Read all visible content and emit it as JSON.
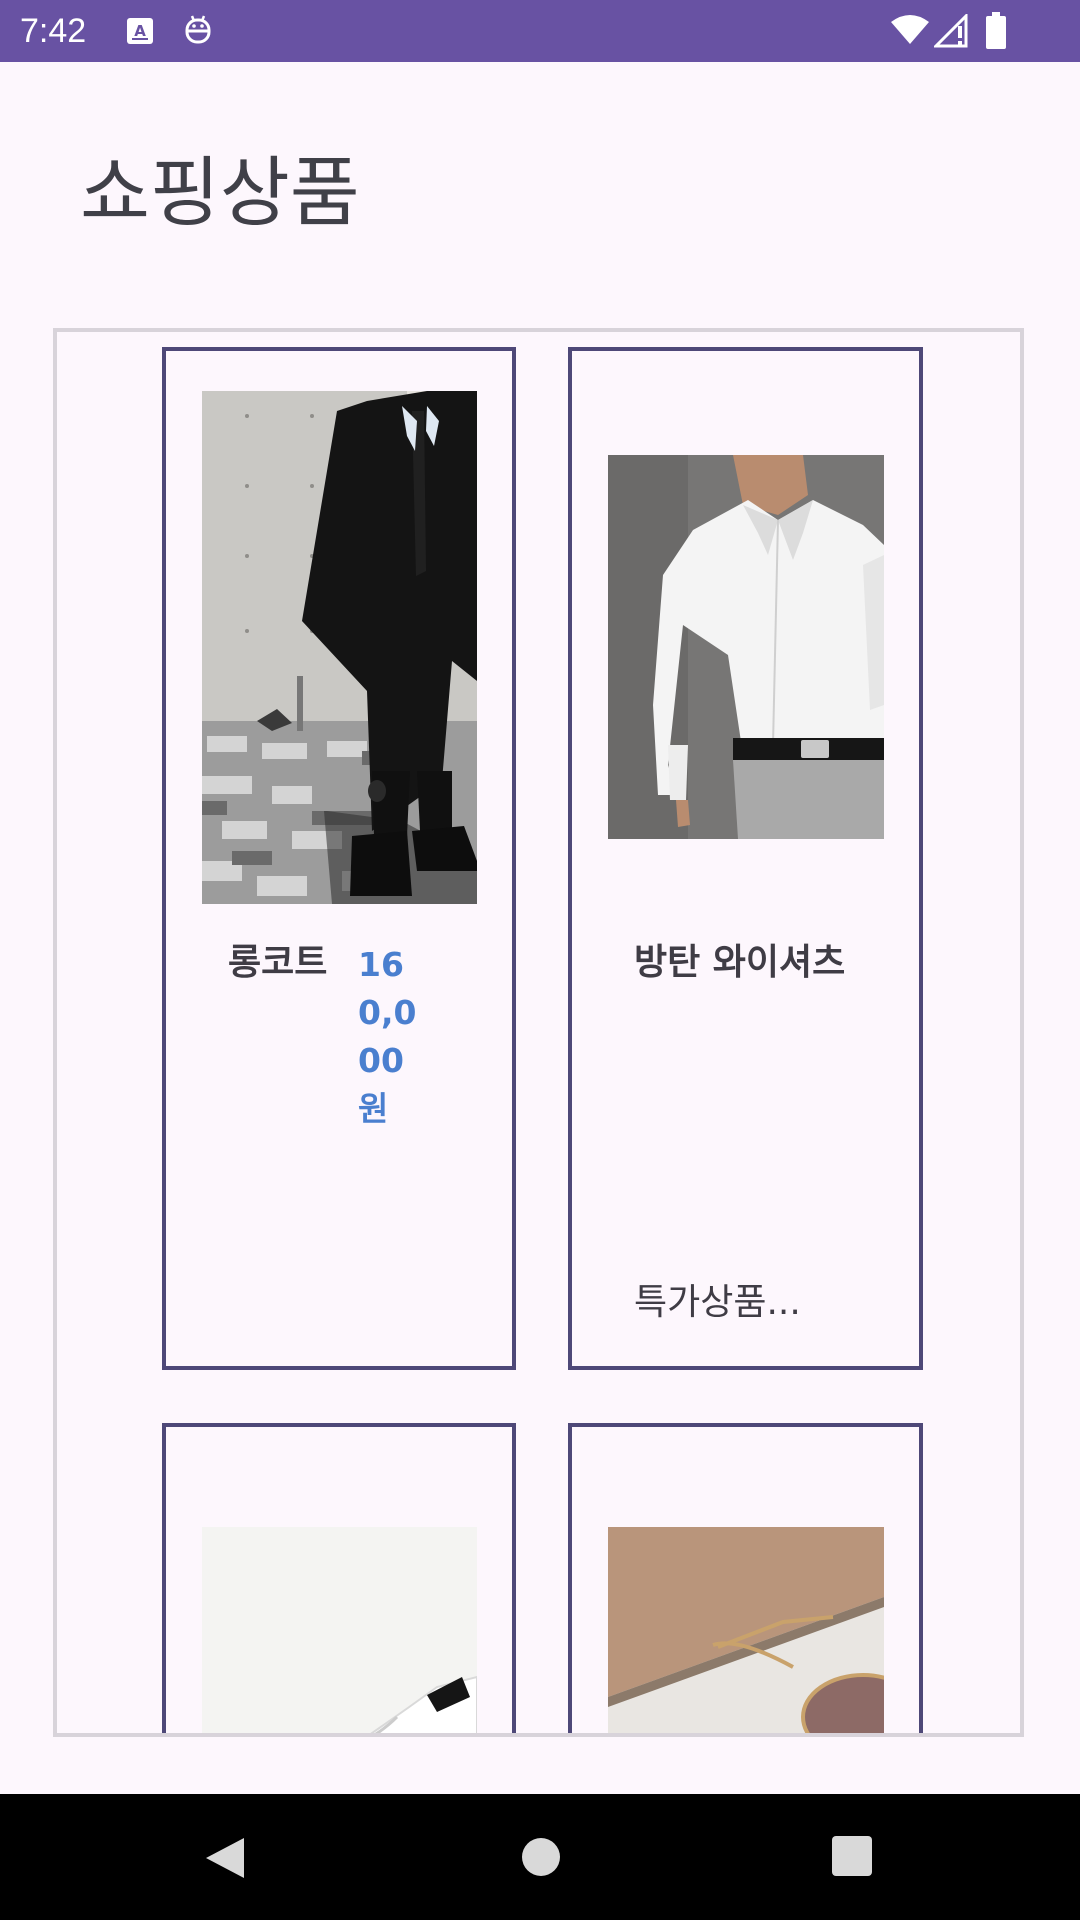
{
  "status_bar": {
    "time": "7:42",
    "background": "#6852a3",
    "left_icons": [
      "text-a-icon",
      "robot-icon"
    ],
    "right_icons": [
      "wifi-icon",
      "signal-icon",
      "battery-icon"
    ]
  },
  "page": {
    "title": "쇼핑상품"
  },
  "products": [
    {
      "name": "롱코트",
      "price": "160,000원",
      "note": "",
      "image": "long-coat-photo"
    },
    {
      "name": "방탄 와이셔츠",
      "price": "",
      "note": "특가상품...",
      "image": "white-shirt-photo"
    },
    {
      "name": "",
      "price": "",
      "note": "",
      "image": "sneakers-photo"
    },
    {
      "name": "",
      "price": "",
      "note": "",
      "image": "sunglasses-photo"
    }
  ],
  "colors": {
    "accent": "#6852a3",
    "card_border": "#4e4878",
    "price": "#4a7fcf",
    "background": "#fdf7fd"
  },
  "nav_bar": {
    "buttons": [
      "back-icon",
      "home-icon",
      "recents-icon"
    ]
  }
}
